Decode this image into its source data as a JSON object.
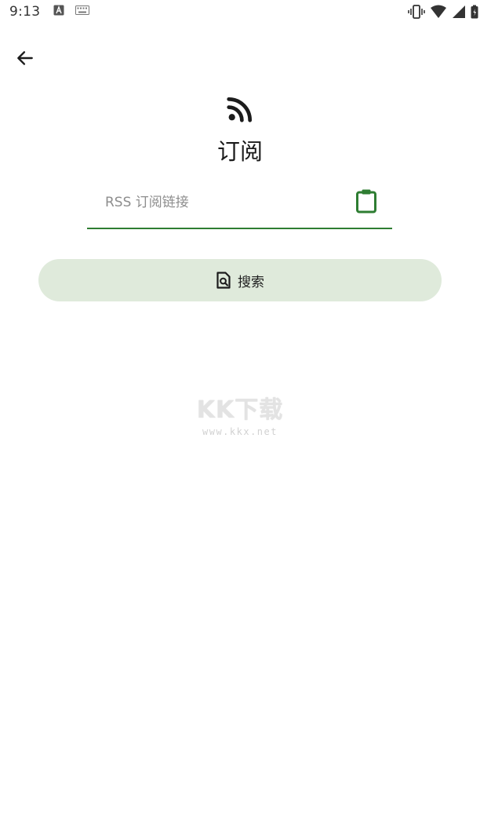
{
  "status_bar": {
    "time": "9:13"
  },
  "header": {
    "back_icon": "arrow-left-icon",
    "feed_icon": "rss-icon",
    "title": "订阅"
  },
  "form": {
    "url_placeholder": "RSS 订阅链接",
    "url_value": "",
    "paste_icon": "clipboard-icon",
    "search_icon": "search-document-icon",
    "search_label": "搜索"
  },
  "watermark": {
    "logo": "KK下载",
    "url": "www.kkx.net"
  },
  "colors": {
    "accent": "#2e7d32",
    "button_bg": "#dfeadb",
    "placeholder": "#8d8d8d"
  }
}
